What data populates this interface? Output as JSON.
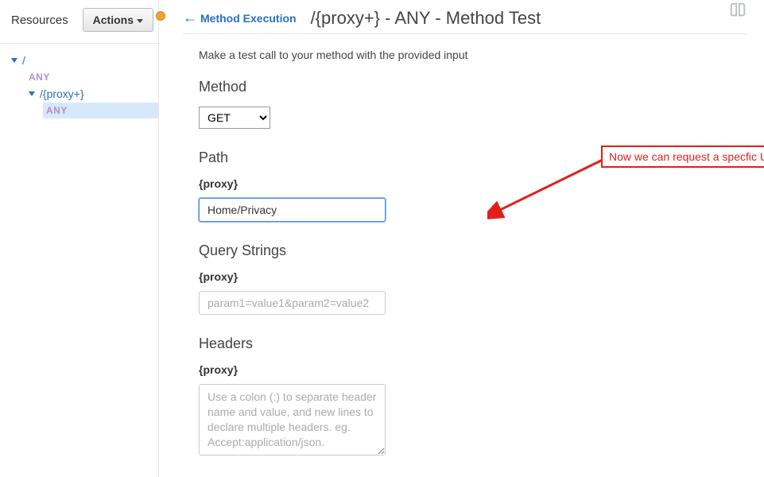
{
  "sidebar": {
    "title": "Resources",
    "actions_label": "Actions",
    "tree": {
      "root": "/",
      "root_method": "ANY",
      "child": "/{proxy+}",
      "child_method": "ANY"
    }
  },
  "header": {
    "back_label": "Method Execution",
    "title": "/{proxy+} - ANY - Method Test"
  },
  "intro": "Make a test call to your method with the provided input",
  "method": {
    "title": "Method",
    "selected": "GET"
  },
  "path": {
    "title": "Path",
    "label": "{proxy}",
    "value": "Home/Privacy"
  },
  "query": {
    "title": "Query Strings",
    "label": "{proxy}",
    "placeholder": "param1=value1&param2=value2"
  },
  "headers": {
    "title": "Headers",
    "label": "{proxy}",
    "placeholder": "Use a colon (:) to separate header name and value, and new lines to declare multiple headers. eg. Accept:application/json."
  },
  "annotation": {
    "text": "Now we can request a specfic URL!"
  }
}
